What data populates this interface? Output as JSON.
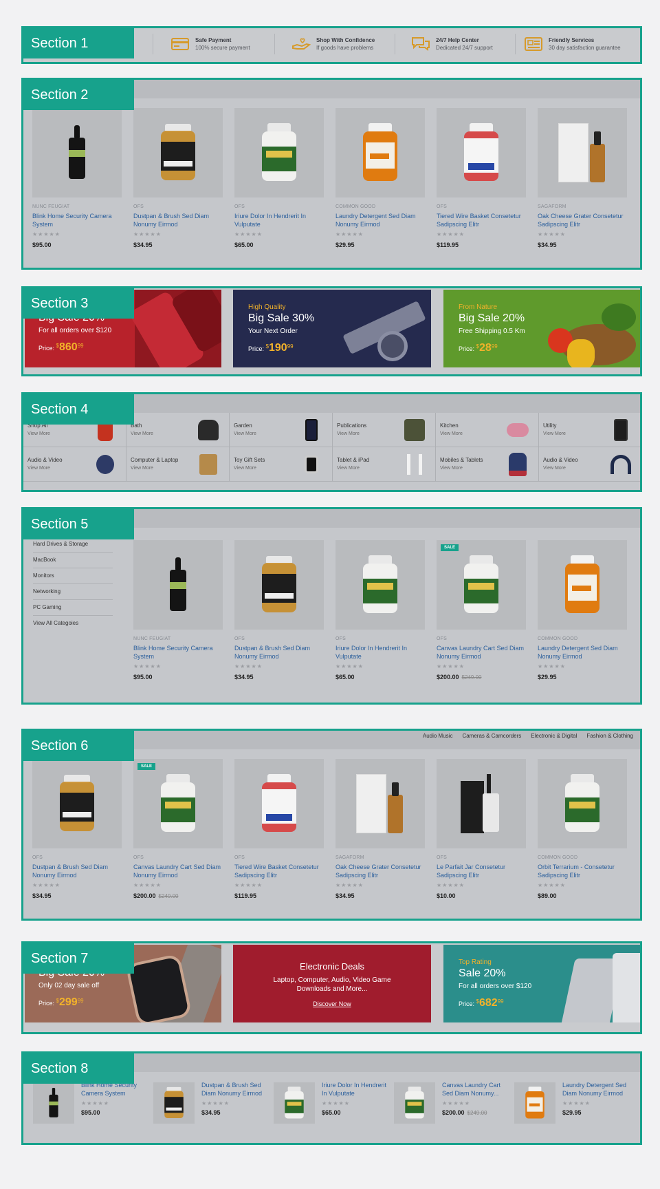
{
  "sections": [
    "Section 1",
    "Section 2",
    "Section 3",
    "Section 4",
    "Section 5",
    "Section 6",
    "Section 7",
    "Section 8"
  ],
  "features": [
    {
      "icon": "card-icon",
      "title": "Safe Payment",
      "sub": "100% secure payment"
    },
    {
      "icon": "hand-heart-icon",
      "title": "Shop With Confidence",
      "sub": "If goods have problems"
    },
    {
      "icon": "chat-icon",
      "title": "24/7 Help Center",
      "sub": "Dedicated 24/7 support"
    },
    {
      "icon": "news-icon",
      "title": "Friendly Services",
      "sub": "30 day satisfaction guarantee"
    }
  ],
  "s2_products": [
    {
      "brand": "NUNC FEUGIAT",
      "name": "Blink Home Security Camera System",
      "price": "$95.00",
      "stars": "★★★★★"
    },
    {
      "brand": "OFS",
      "name": "Dustpan & Brush Sed Diam Nonumy Eirmod",
      "price": "$34.95",
      "stars": "★★★★★"
    },
    {
      "brand": "OFS",
      "name": "Iriure Dolor In Hendrerit In Vulputate",
      "price": "$65.00",
      "stars": "★★★★★"
    },
    {
      "brand": "COMMON GOOD",
      "name": "Laundry Detergent Sed Diam Nonumy Eirmod",
      "price": "$29.95",
      "stars": "★★★★★"
    },
    {
      "brand": "OFS",
      "name": "Tiered Wire Basket Consetetur Sadipscing Elitr",
      "price": "$119.95",
      "stars": "★★★★★"
    },
    {
      "brand": "SAGAFORM",
      "name": "Oak Cheese Grater Consetetur Sadipscing Elitr",
      "price": "$34.95",
      "stars": "★★★★★"
    }
  ],
  "s3_banners": [
    {
      "l1": "",
      "l2": "Big Sale 20%",
      "l3": "For all orders over $120",
      "price_label": "Price:",
      "cur": "$",
      "amount": "860",
      "cents": "99",
      "bg": "#d0202e"
    },
    {
      "l1": "High Quality",
      "l2": "Big Sale 30%",
      "l3": "Your Next Order",
      "price_label": "Price:",
      "cur": "$",
      "amount": "190",
      "cents": "99",
      "bg": "#1d2244"
    },
    {
      "l1": "From Nature",
      "l2": "Big Sale 20%",
      "l3": "Free Shipping 0.5 Km",
      "price_label": "Price:",
      "cur": "$",
      "amount": "28",
      "cents": "99",
      "bg": "#5a8f2a"
    }
  ],
  "s4_cats": [
    {
      "name": "Shop All",
      "more": "View More"
    },
    {
      "name": "Bath",
      "more": "View More"
    },
    {
      "name": "Garden",
      "more": "View More"
    },
    {
      "name": "Publications",
      "more": "View More"
    },
    {
      "name": "Kitchen",
      "more": "View More"
    },
    {
      "name": "Utility",
      "more": "View More"
    },
    {
      "name": "Audio & Video",
      "more": "View More"
    },
    {
      "name": "Computer & Laptop",
      "more": "View More"
    },
    {
      "name": "Toy Gift Sets",
      "more": "View More"
    },
    {
      "name": "Tablet & iPad",
      "more": "View More"
    },
    {
      "name": "Mobiles & Tablets",
      "more": "View More"
    },
    {
      "name": "Audio & Video",
      "more": "View More"
    }
  ],
  "s5_side": [
    "Hard Drives & Storage",
    "MacBook",
    "Monitors",
    "Networking",
    "PC Gaming",
    "View All Categoies"
  ],
  "s5_products": [
    {
      "brand": "NUNC FEUGIAT",
      "name": "Blink Home Security Camera System",
      "price": "$95.00",
      "old": "",
      "stars": "★★★★★",
      "sale": ""
    },
    {
      "brand": "OFS",
      "name": "Dustpan & Brush Sed Diam Nonumy Eirmod",
      "price": "$34.95",
      "old": "",
      "stars": "★★★★★",
      "sale": ""
    },
    {
      "brand": "OFS",
      "name": "Iriure Dolor In Hendrerit In Vulputate",
      "price": "$65.00",
      "old": "",
      "stars": "★★★★★",
      "sale": ""
    },
    {
      "brand": "OFS",
      "name": "Canvas Laundry Cart Sed Diam Nonumy Eirmod",
      "price": "$200.00",
      "old": "$249.00",
      "stars": "★★★★★",
      "sale": "SALE"
    },
    {
      "brand": "COMMON GOOD",
      "name": "Laundry Detergent Sed Diam Nonumy Eirmod",
      "price": "$29.95",
      "old": "",
      "stars": "★★★★★",
      "sale": ""
    }
  ],
  "s6_tabs": [
    "Audio Music",
    "Cameras & Camcorders",
    "Electronic & Digital",
    "Fashion & Clothing"
  ],
  "s6_products": [
    {
      "brand": "OFS",
      "name": "Dustpan & Brush Sed Diam Nonumy Eirmod",
      "price": "$34.95",
      "old": "",
      "stars": "★★★★★",
      "sale": ""
    },
    {
      "brand": "OFS",
      "name": "Canvas Laundry Cart Sed Diam Nonumy Eirmod",
      "price": "$200.00",
      "old": "$249.00",
      "stars": "★★★★★",
      "sale": "SALE"
    },
    {
      "brand": "OFS",
      "name": "Tiered Wire Basket Consetetur Sadipscing Elitr",
      "price": "$119.95",
      "old": "",
      "stars": "★★★★★",
      "sale": ""
    },
    {
      "brand": "SAGAFORM",
      "name": "Oak Cheese Grater Consetetur Sadipscing Elitr",
      "price": "$34.95",
      "old": "",
      "stars": "★★★★★",
      "sale": ""
    },
    {
      "brand": "OFS",
      "name": "Le Parfait Jar Consetetur Sadipscing Elitr",
      "price": "$10.00",
      "old": "",
      "stars": "★★★★★",
      "sale": ""
    },
    {
      "brand": "COMMON GOOD",
      "name": "Orbit Terrarium - Consetetur Sadipscing Elitr",
      "price": "$89.00",
      "old": "",
      "stars": "★★★★★",
      "sale": ""
    }
  ],
  "s7_banners": {
    "left": {
      "l2": "Big Sale 20%",
      "l3": "Only 02 day sale off",
      "price_label": "Price:",
      "cur": "$",
      "amount": "299",
      "cents": "99"
    },
    "mid": {
      "title": "Electronic Deals",
      "text": "Laptop, Computer, Audio, Video Game Downloads and More...",
      "link": "Discover Now"
    },
    "right": {
      "l1": "Top Rating",
      "l2": "Sale 20%",
      "l3": "For all orders over $120",
      "price_label": "Price:",
      "cur": "$",
      "amount": "682",
      "cents": "99"
    }
  },
  "s8_products": [
    {
      "name": "Blink Home Security Camera System",
      "price": "$95.00",
      "old": "",
      "stars": "★★★★★"
    },
    {
      "name": "Dustpan & Brush Sed Diam Nonumy Eirmod",
      "price": "$34.95",
      "old": "",
      "stars": "★★★★★"
    },
    {
      "name": "Iriure Dolor In Hendrerit In Vulputate",
      "price": "$65.00",
      "old": "",
      "stars": "★★★★★"
    },
    {
      "name": "Canvas Laundry Cart Sed Diam Nonumy...",
      "price": "$200.00",
      "old": "$249.00",
      "stars": "★★★★★"
    },
    {
      "name": "Laundry Detergent Sed Diam Nonumy Eirmod",
      "price": "$29.95",
      "old": "",
      "stars": "★★★★★"
    }
  ],
  "colors": {
    "accent": "#17a28c",
    "link": "#2b5f9c",
    "price_highlight": "#f2b22a"
  }
}
